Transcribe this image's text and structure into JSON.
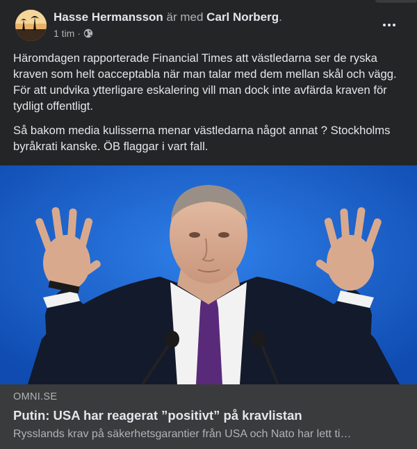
{
  "post": {
    "author": "Hasse Hermansson",
    "with_text": " är med ",
    "tagged": "Carl Norberg",
    "period": ".",
    "time": "1 tim",
    "separator": "·",
    "paragraphs": [
      "Häromdagen rapporterade Financial Times att västledarna ser de ryska kraven som helt oacceptabla när man talar med dem mellan skål och vägg. För att undvika ytterligare eskalering vill man dock inte avfärda kraven för tydligt offentligt.",
      "Så bakom media kulisserna menar västledarna något annat ? Stockholms byråkrati kanske. ÖB flaggar i vart fall."
    ]
  },
  "link": {
    "domain": "OMNI.SE",
    "title": "Putin: USA har reagerat ”positivt” på kravlistan",
    "description": "Rysslands krav på säkerhetsgarantier från USA och Nato har lett ti…"
  },
  "colors": {
    "background": "#242526",
    "link_panel": "#3a3b3c",
    "primary_text": "#e4e6eb",
    "secondary_text": "#b0b3b8",
    "photo_backdrop": "#1e63c9"
  }
}
